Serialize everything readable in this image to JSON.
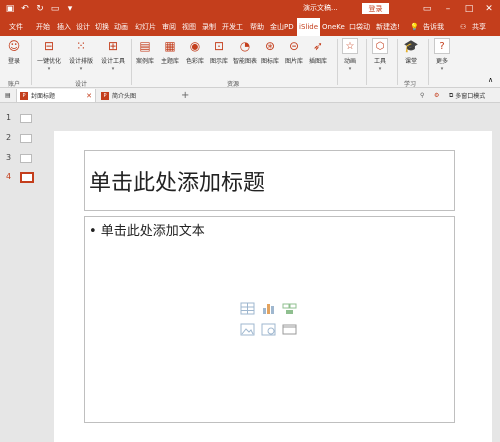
{
  "titlebar": {
    "doc_title": "演示文稿...",
    "login": "登录"
  },
  "menu": {
    "tabs": [
      "文件",
      "开始",
      "插入",
      "设计",
      "切换",
      "动画",
      "幻灯片",
      "审阅",
      "视图",
      "录制",
      "开发工",
      "帮助",
      "金山PD",
      "iSlide",
      "OneKe",
      "口袋动",
      "新建选!"
    ],
    "tell_me": "告诉我",
    "share": "共享"
  },
  "ribbon": {
    "account": {
      "login": "登录",
      "group": "账户"
    },
    "design": {
      "one_click": "一键优化",
      "layout": "设计排版",
      "tools": "设计工具",
      "group": "设计"
    },
    "resources": {
      "items": [
        "案例库",
        "主题库",
        "色彩库",
        "图示库",
        "智能图表",
        "图标库",
        "图片库",
        "插图库"
      ],
      "group": "资源"
    },
    "animation": {
      "label": "动画"
    },
    "tools": {
      "label": "工具"
    },
    "learn": {
      "label": "课堂",
      "group": "学习"
    },
    "more": {
      "label": "更多"
    }
  },
  "doctabs": {
    "tab1": "封面标题",
    "tab2": "简介头图",
    "multi_window": "多窗口模式"
  },
  "thumbnails": [
    "1",
    "2",
    "3",
    "4"
  ],
  "slide": {
    "title_placeholder": "单击此处添加标题",
    "body_placeholder": "• 单击此处添加文本"
  },
  "colors": {
    "accent": "#c43e1c"
  }
}
